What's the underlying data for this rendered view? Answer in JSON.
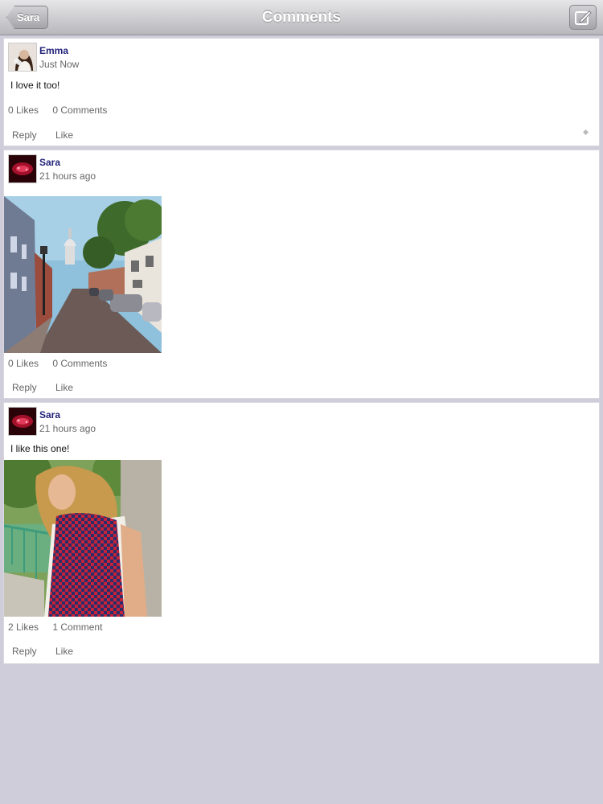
{
  "nav": {
    "title": "Comments",
    "back_label": "Sara",
    "compose_icon": "compose-icon"
  },
  "posts": [
    {
      "author": "Emma",
      "time": "Just Now",
      "text": "I love it too!",
      "likes": "0 Likes",
      "comments": "0 Comments",
      "reply_label": "Reply",
      "like_label": "Like"
    },
    {
      "author": "Sara",
      "time": "21 hours ago",
      "likes": "0 Likes",
      "comments": "0 Comments",
      "reply_label": "Reply",
      "like_label": "Like"
    },
    {
      "author": "Sara",
      "time": "21 hours ago",
      "text": "I like this one!",
      "likes": "2 Likes",
      "comments": "1 Comment",
      "reply_label": "Reply",
      "like_label": "Like"
    }
  ]
}
